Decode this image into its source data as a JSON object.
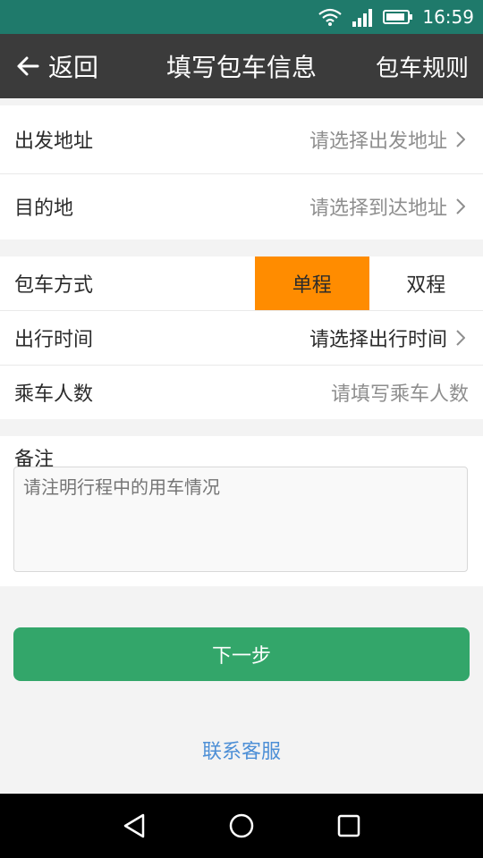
{
  "status_bar": {
    "time": "16:59"
  },
  "header": {
    "back_label": "返回",
    "title": "填写包车信息",
    "rules_label": "包车规则"
  },
  "address_section": {
    "departure": {
      "label": "出发地址",
      "placeholder": "请选择出发地址"
    },
    "destination": {
      "label": "目的地",
      "placeholder": "请选择到达地址"
    }
  },
  "trip_section": {
    "mode": {
      "label": "包车方式",
      "options": [
        "单程",
        "双程"
      ],
      "selected": "单程"
    },
    "time": {
      "label": "出行时间",
      "placeholder": "请选择出行时间"
    },
    "passengers": {
      "label": "乘车人数",
      "placeholder": "请填写乘车人数"
    }
  },
  "remark": {
    "label": "备注",
    "placeholder": "请注明行程中的用车情况"
  },
  "actions": {
    "next_label": "下一步",
    "contact_label": "联系客服"
  },
  "colors": {
    "accent": "#ff8c00",
    "primary": "#33a66a",
    "link": "#4d8fd6",
    "header": "#3b3b3b"
  }
}
